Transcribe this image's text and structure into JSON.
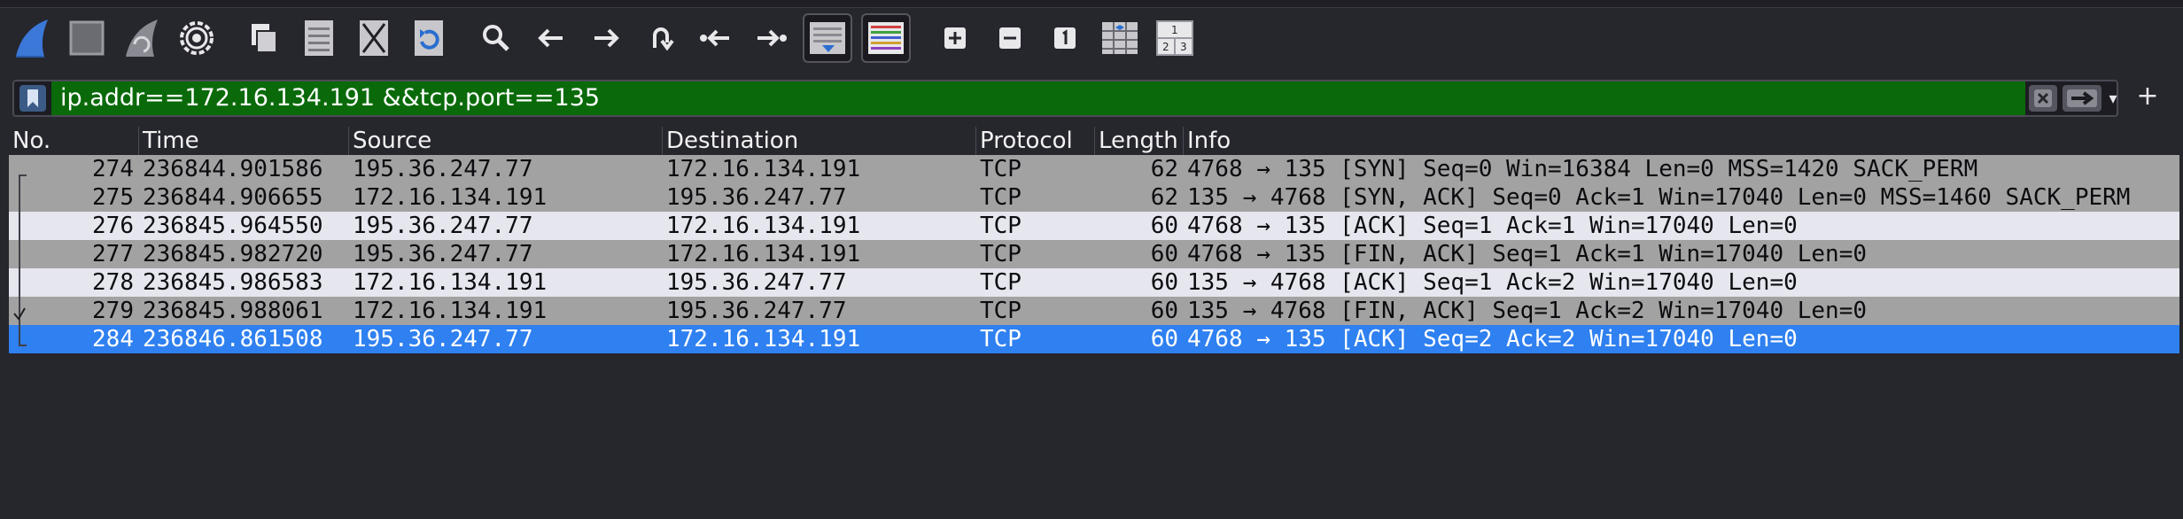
{
  "toolbar": {
    "buttons": [
      {
        "name": "start-capture-shark-fin-icon"
      },
      {
        "name": "stop-capture-square-icon"
      },
      {
        "name": "restart-capture-fin-icon"
      },
      {
        "name": "capture-options-gear-icon"
      },
      {
        "name": "open-file-icon"
      },
      {
        "name": "save-file-icon"
      },
      {
        "name": "close-file-icon"
      },
      {
        "name": "reload-file-icon"
      },
      {
        "name": "find-packet-magnifier-icon"
      },
      {
        "name": "go-back-arrow-icon"
      },
      {
        "name": "go-forward-arrow-icon"
      },
      {
        "name": "go-to-packet-icon"
      },
      {
        "name": "first-packet-icon"
      },
      {
        "name": "last-packet-icon"
      },
      {
        "name": "auto-scroll-icon"
      },
      {
        "name": "colorize-icon"
      },
      {
        "name": "zoom-in-icon"
      },
      {
        "name": "zoom-out-icon"
      },
      {
        "name": "normal-size-icon"
      },
      {
        "name": "resize-columns-icon"
      },
      {
        "name": "layout-panes-icon"
      }
    ]
  },
  "filter": {
    "value": "ip.addr==172.16.134.191 &&tcp.port==135",
    "placeholder": "",
    "bg_color": "#0a6a0a"
  },
  "packet_list": {
    "columns": [
      "No.",
      "Time",
      "Source",
      "Destination",
      "Protocol",
      "Length",
      "Info"
    ],
    "rows": [
      {
        "no": "274",
        "time": "236844.901586",
        "src": "195.36.247.77",
        "dst": "172.16.134.191",
        "proto": "TCP",
        "len": "62",
        "info": "4768 → 135 [SYN] Seq=0 Win=16384 Len=0 MSS=1420 SACK_PERM",
        "style": "gray"
      },
      {
        "no": "275",
        "time": "236844.906655",
        "src": "172.16.134.191",
        "dst": "195.36.247.77",
        "proto": "TCP",
        "len": "62",
        "info": "135 → 4768 [SYN, ACK] Seq=0 Ack=1 Win=17040 Len=0 MSS=1460 SACK_PERM",
        "style": "gray"
      },
      {
        "no": "276",
        "time": "236845.964550",
        "src": "195.36.247.77",
        "dst": "172.16.134.191",
        "proto": "TCP",
        "len": "60",
        "info": "4768 → 135 [ACK] Seq=1 Ack=1 Win=17040 Len=0",
        "style": "light"
      },
      {
        "no": "277",
        "time": "236845.982720",
        "src": "195.36.247.77",
        "dst": "172.16.134.191",
        "proto": "TCP",
        "len": "60",
        "info": "4768 → 135 [FIN, ACK] Seq=1 Ack=1 Win=17040 Len=0",
        "style": "gray"
      },
      {
        "no": "278",
        "time": "236845.986583",
        "src": "172.16.134.191",
        "dst": "195.36.247.77",
        "proto": "TCP",
        "len": "60",
        "info": "135 → 4768 [ACK] Seq=1 Ack=2 Win=17040 Len=0",
        "style": "light"
      },
      {
        "no": "279",
        "time": "236845.988061",
        "src": "172.16.134.191",
        "dst": "195.36.247.77",
        "proto": "TCP",
        "len": "60",
        "info": "135 → 4768 [FIN, ACK] Seq=1 Ack=2 Win=17040 Len=0",
        "style": "gray"
      },
      {
        "no": "284",
        "time": "236846.861508",
        "src": "195.36.247.77",
        "dst": "172.16.134.191",
        "proto": "TCP",
        "len": "60",
        "info": "4768 → 135 [ACK] Seq=2 Ack=2 Win=17040 Len=0",
        "style": "selected"
      }
    ]
  },
  "colors": {
    "background": "#26262d",
    "row_gray": "#a2a2a2",
    "row_light": "#e6e6ef",
    "row_selected": "#2f80f0",
    "filter_valid": "#0a6a0a"
  }
}
